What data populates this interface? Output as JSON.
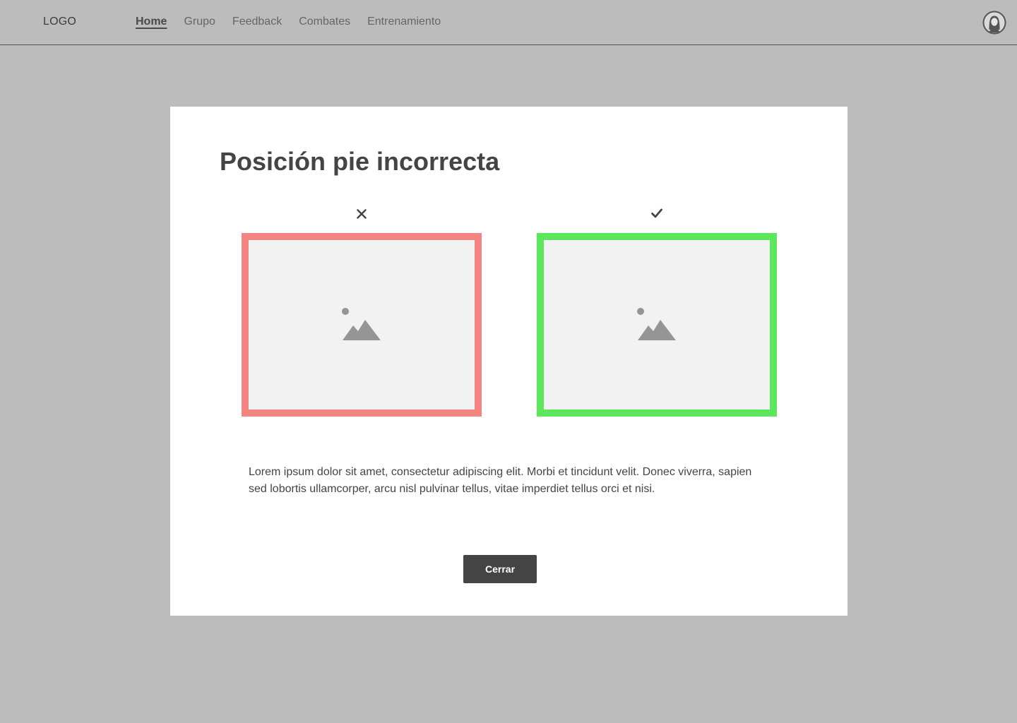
{
  "header": {
    "logo": "LOGO",
    "nav": [
      {
        "label": "Home",
        "active": true
      },
      {
        "label": "Grupo",
        "active": false
      },
      {
        "label": "Feedback",
        "active": false
      },
      {
        "label": "Combates",
        "active": false
      },
      {
        "label": "Entrenamiento",
        "active": false
      }
    ],
    "avatar_icon": "user-avatar-icon"
  },
  "modal": {
    "title": "Posición pie incorrecta",
    "incorrect_example": {
      "mark_icon": "cross-icon",
      "image_icon": "image-placeholder-icon",
      "border_color": "#f28482"
    },
    "correct_example": {
      "mark_icon": "checkmark-icon",
      "image_icon": "image-placeholder-icon",
      "border_color": "#5ce65c"
    },
    "description": "Lorem ipsum dolor sit amet, consectetur adipiscing elit. Morbi et tincidunt velit. Donec viverra, sapien sed lobortis ullamcorper, arcu nisl pulvinar tellus, vitae imperdiet tellus orci et nisi.",
    "close_label": "Cerrar"
  },
  "colors": {
    "background": "#bcbcbc",
    "modal_background": "#ffffff",
    "button_background": "#444444",
    "text": "#444444"
  }
}
